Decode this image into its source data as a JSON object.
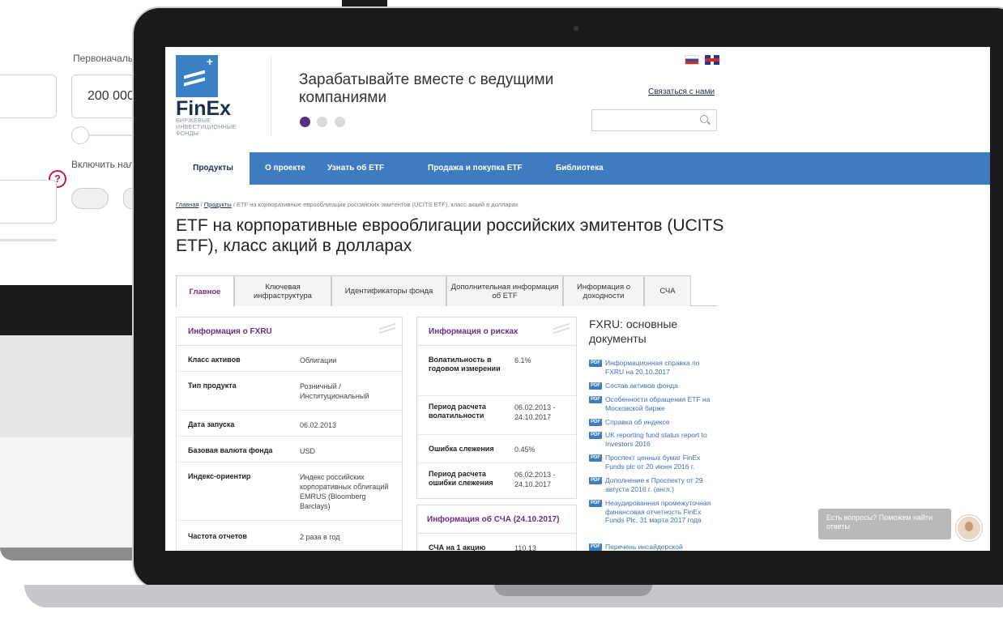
{
  "background": {
    "label_initial": "Первоначаль",
    "initial_value": "200 000",
    "label_include": "Включить нал",
    "help_symbol": "?"
  },
  "header": {
    "logo_name": "FinEx",
    "logo_sub": "БИРЖЕВЫЕ ИНВЕСТИЦИОННЫЕ ФОНДЫ",
    "tagline": "Зарабатывайте вместе с ведущими компаниями",
    "contact_link": "Связаться с нами",
    "search_placeholder": ""
  },
  "nav": {
    "items": [
      {
        "label": "Продукты"
      },
      {
        "label": "О проекте"
      },
      {
        "label": "Узнать об ETF"
      },
      {
        "label": "Продажа и покупка ETF"
      },
      {
        "label": "Библиотека"
      }
    ]
  },
  "breadcrumb": {
    "home": "Главная",
    "products": "Продукты",
    "current": "ETF на корпоративные еврооблигации российских эмитентов (UCITS ETF), класс акций в долларах"
  },
  "page_title": "ETF на корпоративные еврооблигации российских эмитентов (UCITS ETF), класс акций в долларах",
  "tabs": [
    {
      "label": "Главное"
    },
    {
      "label": "Ключевая инфраструктура"
    },
    {
      "label": "Идентификаторы фонда"
    },
    {
      "label": "Дополнительная информация об ETF"
    },
    {
      "label": "Информация о доходности"
    },
    {
      "label": "СЧА"
    }
  ],
  "info_card": {
    "title": "Информация о FXRU",
    "rows": [
      {
        "key": "Класс активов",
        "value": "Облигации"
      },
      {
        "key": "Тип продукта",
        "value": "Розничный / Институциональный"
      },
      {
        "key": "Дата запуска",
        "value": "06.02.2013"
      },
      {
        "key": "Базовая валюта фонда",
        "value": "USD"
      },
      {
        "key": "Индекс-ориентир",
        "value": "Индекс российских корпоративных облигаций EMRUS (Bloomberg Barclays)"
      },
      {
        "key": "Частота отчетов",
        "value": "2 раза в год"
      }
    ]
  },
  "risk_card": {
    "title": "Информация о рисках",
    "rows": [
      {
        "key": "Волатильность в годовом измерении",
        "value": "6.1%"
      },
      {
        "key": "Период расчета волатильности",
        "value": "06.02.2013 - 24.10.2017"
      },
      {
        "key": "Ошибка слежения",
        "value": "0.45%"
      },
      {
        "key": "Период расчета ошибки слежения",
        "value": "06.02.2013 - 24.10.2017"
      }
    ]
  },
  "nav_card": {
    "title": "Информация об СЧА (24.10.2017)",
    "rows": [
      {
        "key": "СЧА на 1 акцию",
        "value": "110.13"
      }
    ]
  },
  "documents": {
    "title": "FXRU: основные документы",
    "badge": "PDF",
    "items": [
      {
        "label": "Информационная справка по FXRU на 20.10.2017"
      },
      {
        "label": "Состав активов фонда"
      },
      {
        "label": "Особенности обращения ETF на Московской бирже"
      },
      {
        "label": "Справка об индексе"
      },
      {
        "label": "UK reporting fund status report to Investors 2016"
      },
      {
        "label": "Проспект ценных бумаг FinEx Funds plc от 20 июня 2016 г."
      },
      {
        "label": "Дополнение к Проспекту от 29 августа 2016 г. (англ.)"
      },
      {
        "label": "Неаудированная промежуточная финансовая отчетность FinEx Funds Plc, 31 марта 2017 года"
      },
      {
        "label": "Перечень инсайдерской"
      }
    ]
  },
  "chat": {
    "text": "Есть вопросы? Поможем найти ответы"
  }
}
